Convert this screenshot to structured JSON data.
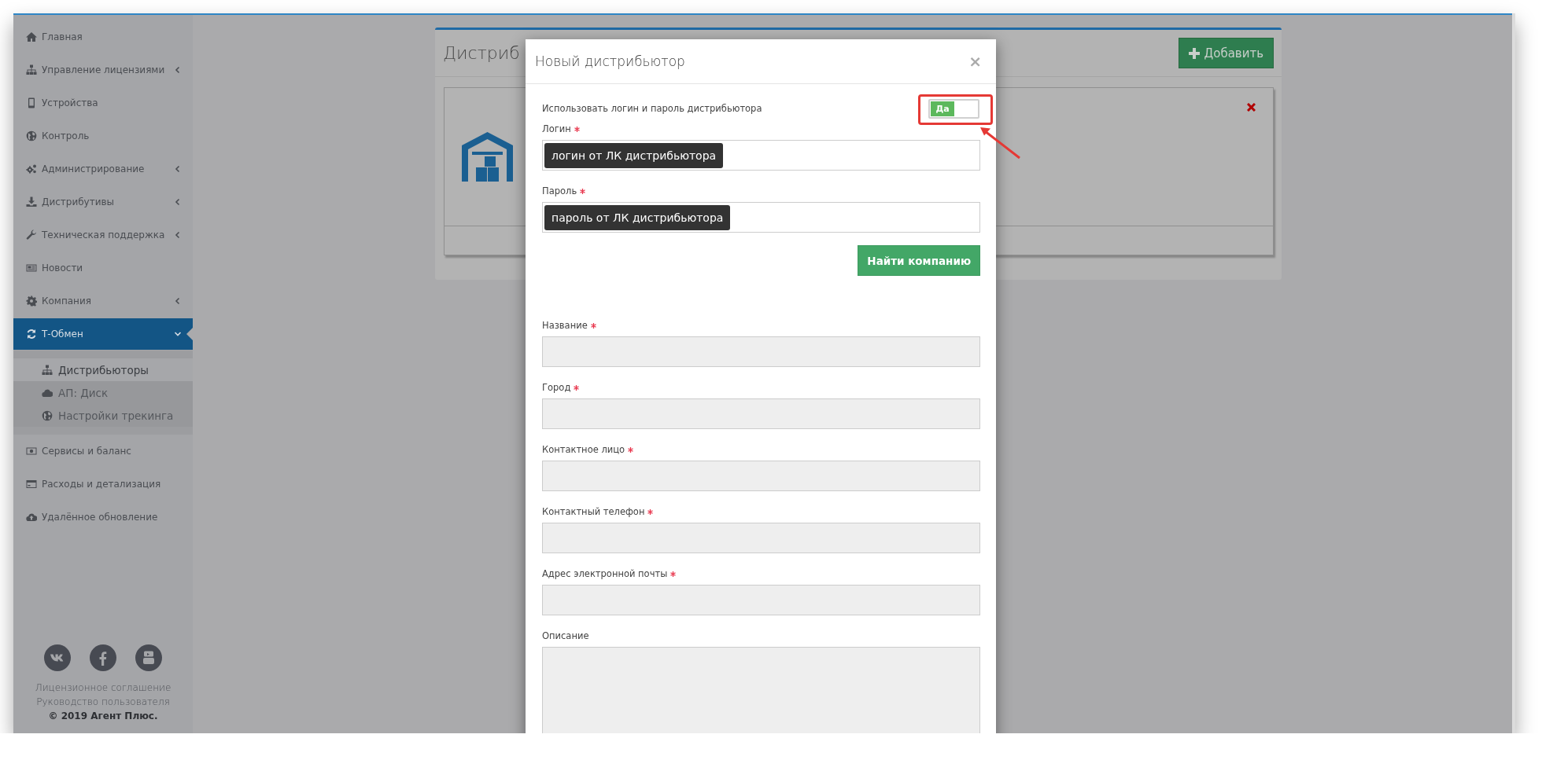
{
  "sidebar": {
    "items": [
      {
        "label": "Главная",
        "selected": false
      },
      {
        "label": "Управление лицензиями",
        "selected": false,
        "expandable": true,
        "expanded": false
      },
      {
        "label": "Устройства",
        "selected": false
      },
      {
        "label": "Контроль",
        "selected": false
      },
      {
        "label": "Администрирование",
        "selected": false,
        "expandable": true,
        "expanded": false
      },
      {
        "label": "Дистрибутивы",
        "selected": false,
        "expandable": true,
        "expanded": false
      },
      {
        "label": "Техническая поддержка",
        "selected": false,
        "expandable": true,
        "expanded": false
      },
      {
        "label": "Новости",
        "selected": false
      },
      {
        "label": "Компания",
        "selected": false,
        "expandable": true,
        "expanded": false
      },
      {
        "label": "Т-Обмен",
        "selected": true,
        "expandable": true,
        "expanded": true,
        "children": [
          {
            "label": "Дистрибьюторы",
            "selected": true
          },
          {
            "label": "АП: Диск",
            "selected": false
          },
          {
            "label": "Настройки трекинга",
            "selected": false
          }
        ]
      },
      {
        "label": "Сервисы и баланс",
        "selected": false
      },
      {
        "label": "Расходы и детализация",
        "selected": false
      },
      {
        "label": "Удалённое обновление",
        "selected": false
      }
    ],
    "footer": {
      "links": [
        "Лицензионное соглашение",
        "Руководство пользователя"
      ],
      "copyright": "© 2019 Агент Плюс."
    }
  },
  "page": {
    "title": "Дистриб",
    "add_button": "Добавить"
  },
  "modal": {
    "title": "Новый дистрибьютор",
    "close": "×",
    "switch": {
      "label": "Использовать логин и пароль дистрибьютора",
      "state_label": "Да",
      "on": true
    },
    "credentials": [
      {
        "label": "Логин",
        "required": true,
        "kind": "text",
        "disabled": false,
        "callout": "логин от ЛК дистрибьютора"
      },
      {
        "label": "Пароль",
        "required": true,
        "kind": "text",
        "disabled": false,
        "callout": "пароль от ЛК дистрибьютора"
      }
    ],
    "find_button": "Найти компанию",
    "fields": [
      {
        "label": "Название",
        "required": true,
        "kind": "text",
        "disabled": true
      },
      {
        "label": "Город",
        "required": true,
        "kind": "text",
        "disabled": true
      },
      {
        "label": "Контактное лицо",
        "required": true,
        "kind": "text",
        "disabled": true
      },
      {
        "label": "Контактный телефон",
        "required": true,
        "kind": "text",
        "disabled": true
      },
      {
        "label": "Адрес электронной почты",
        "required": true,
        "kind": "text",
        "disabled": true
      },
      {
        "label": "Описание",
        "required": false,
        "kind": "textarea",
        "disabled": true
      }
    ]
  }
}
